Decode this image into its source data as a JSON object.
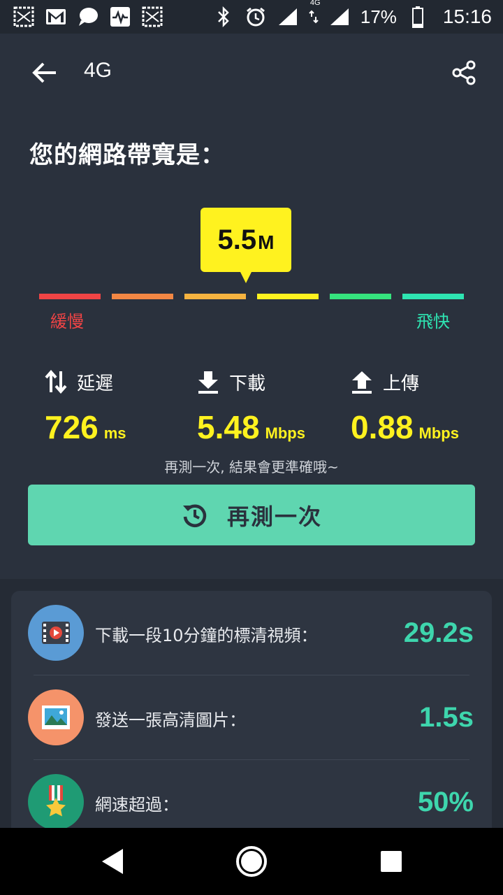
{
  "status_bar": {
    "battery": "17%",
    "time": "15:16",
    "network_badge": "4G",
    "icons": [
      "notification-icon",
      "gmail-icon",
      "chat-icon",
      "activity-icon",
      "notification-icon",
      "bluetooth-icon",
      "alarm-icon",
      "signal-icon",
      "signal-icon",
      "battery-icon"
    ]
  },
  "app_bar": {
    "title": "4G"
  },
  "heading": "您的網路帶寬是：",
  "gauge": {
    "value": "5.5",
    "unit": "M",
    "slow_label": "緩慢",
    "fast_label": "飛快",
    "segment_colors": [
      "#f04445",
      "#f38744",
      "#f6b340",
      "#fff21f",
      "#35e47e",
      "#2ee5b2"
    ]
  },
  "metrics": [
    {
      "label": "延遲",
      "value": "726",
      "unit": "ms",
      "icon": "latency-arrows-icon"
    },
    {
      "label": "下載",
      "value": "5.48",
      "unit": "Mbps",
      "icon": "download-icon"
    },
    {
      "label": "上傳",
      "value": "0.88",
      "unit": "Mbps",
      "icon": "upload-icon"
    }
  ],
  "hint": "再測一次, 結果會更準確哦~",
  "retest_button": {
    "label": "再測一次"
  },
  "results": [
    {
      "label": "下載一段10分鐘的標清視頻：",
      "value": "29.2s",
      "icon": "video-icon",
      "icon_bg": "#5a9bd5"
    },
    {
      "label": "發送一張高清圖片：",
      "value": "1.5s",
      "icon": "image-icon",
      "icon_bg": "#f5936a"
    },
    {
      "label": "網速超過：",
      "value": "50%",
      "icon": "medal-icon",
      "icon_bg": "#1f9b74"
    }
  ],
  "colors": {
    "background": "#2a313d",
    "accent": "#5fd6b0",
    "highlight": "#fff21f",
    "result_value": "#3ed6ad"
  }
}
